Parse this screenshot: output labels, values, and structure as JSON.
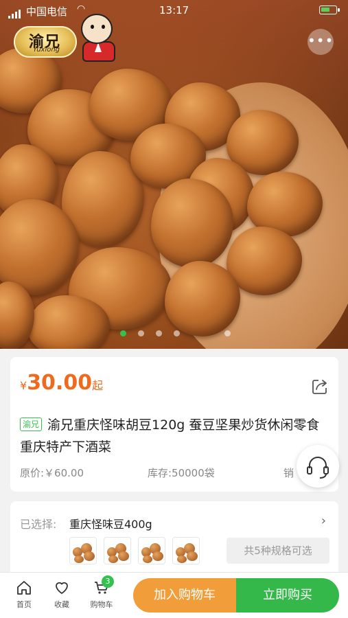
{
  "status_bar": {
    "carrier": "中国电信",
    "time": "13:17"
  },
  "brand": {
    "logo_text": "渝兄",
    "logo_sub": "Yuxiong"
  },
  "gallery": {
    "current_slide": 1,
    "total_slides": 5
  },
  "product": {
    "currency": "¥",
    "price": "30.00",
    "price_suffix": "起",
    "tag": "渝兄",
    "title": "渝兄重庆怪味胡豆120g 蚕豆坚果炒货休闲零食重庆特产下酒菜",
    "original_price": "原价:￥60.00",
    "stock": "库存:50000袋",
    "sales": "销"
  },
  "spec": {
    "label": "已选择:",
    "selected": "重庆怪味豆400g",
    "count_text": "共5种规格可选"
  },
  "tabbar": {
    "home": "首页",
    "favorite": "收藏",
    "cart": "购物车",
    "cart_badge": "3"
  },
  "actions": {
    "add_to_cart": "加入购物车",
    "buy_now": "立即购买"
  },
  "colors": {
    "accent_green": "#35c14f",
    "price_orange": "#f06a1e",
    "cart_button": "#f19d3a",
    "buy_button": "#34b84a"
  }
}
